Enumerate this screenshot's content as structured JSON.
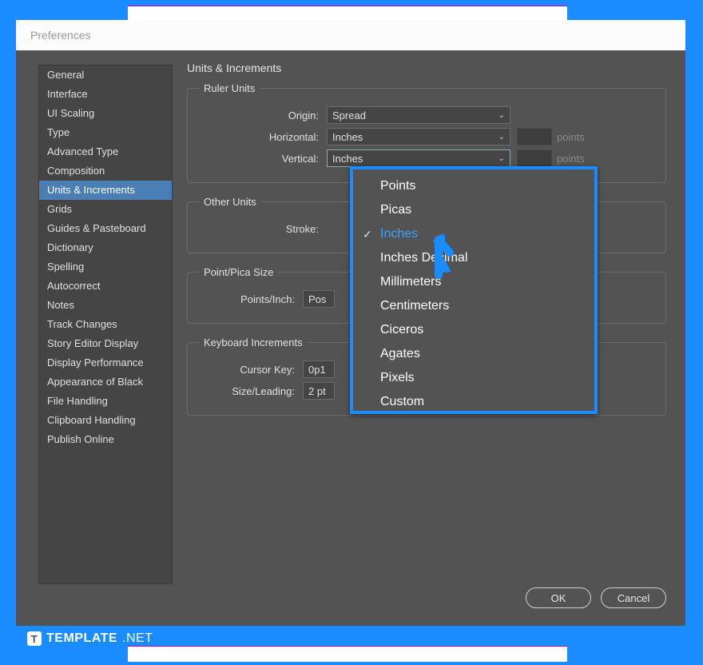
{
  "dialog": {
    "title": "Preferences"
  },
  "sidebar": {
    "items": [
      {
        "label": "General"
      },
      {
        "label": "Interface"
      },
      {
        "label": "UI Scaling"
      },
      {
        "label": "Type"
      },
      {
        "label": "Advanced Type"
      },
      {
        "label": "Composition"
      },
      {
        "label": "Units & Increments",
        "active": true
      },
      {
        "label": "Grids"
      },
      {
        "label": "Guides & Pasteboard"
      },
      {
        "label": "Dictionary"
      },
      {
        "label": "Spelling"
      },
      {
        "label": "Autocorrect"
      },
      {
        "label": "Notes"
      },
      {
        "label": "Track Changes"
      },
      {
        "label": "Story Editor Display"
      },
      {
        "label": "Display Performance"
      },
      {
        "label": "Appearance of Black"
      },
      {
        "label": "File Handling"
      },
      {
        "label": "Clipboard Handling"
      },
      {
        "label": "Publish Online"
      }
    ]
  },
  "panel": {
    "title": "Units & Increments",
    "ruler": {
      "legend": "Ruler Units",
      "origin_label": "Origin:",
      "origin_value": "Spread",
      "horizontal_label": "Horizontal:",
      "horizontal_value": "Inches",
      "vertical_label": "Vertical:",
      "vertical_value": "Inches",
      "points_suffix": "points"
    },
    "other": {
      "legend": "Other Units",
      "stroke_label": "Stroke:"
    },
    "pointpica": {
      "legend": "Point/Pica Size",
      "ppi_label": "Points/Inch:",
      "ppi_value": "Pos"
    },
    "keyboard": {
      "legend": "Keyboard Increments",
      "cursor_label": "Cursor Key:",
      "cursor_value": "0p1",
      "size_label": "Size/Leading:",
      "size_value": "2 pt"
    }
  },
  "dropdown": {
    "items": [
      {
        "label": "Points"
      },
      {
        "label": "Picas"
      },
      {
        "label": "Inches",
        "selected": true
      },
      {
        "label": "Inches Decimal"
      },
      {
        "label": "Millimeters"
      },
      {
        "label": "Centimeters"
      },
      {
        "label": "Ciceros"
      },
      {
        "label": "Agates"
      },
      {
        "label": "Pixels"
      },
      {
        "label": "Custom"
      }
    ]
  },
  "buttons": {
    "ok": "OK",
    "cancel": "Cancel"
  },
  "watermark": {
    "brand": "TEMPLATE",
    "suffix": ".NET",
    "logo": "T"
  }
}
